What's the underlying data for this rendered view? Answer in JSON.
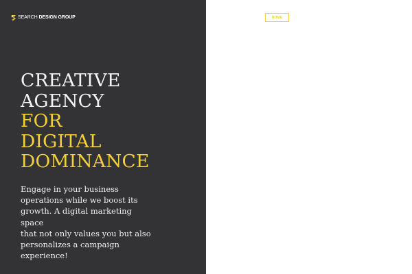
{
  "brand": {
    "logo_icon": "yellow-lightning-s-icon",
    "name_light": "SEARCH",
    "name_bold": "DESIGN GROUP",
    "accent_color": "#f2cf3b"
  },
  "navigation": {
    "home_label": "HOME"
  },
  "hero": {
    "lines": [
      "CREATIVE",
      "AGENCY",
      "FOR",
      "DIGITAL",
      "DOMINANCE"
    ],
    "description": "Engage in your business\noperations while we boost its\ngrowth. A digital marketing space\nthat not only values you but also\npersonalizes a campaign\nexperience!"
  },
  "theme": {
    "left_panel_color": "#333336",
    "right_panel_color": "#ffffff",
    "text_color": "#f3f3f3"
  }
}
